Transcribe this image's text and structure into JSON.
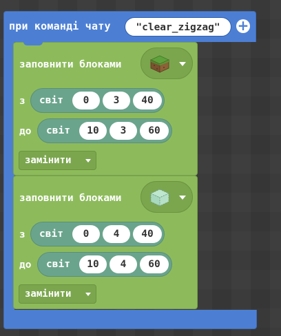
{
  "event": {
    "title": "при команді чату",
    "command": "\"clear_zigzag\"",
    "add_icon": "plus-circle-icon",
    "color": "#4c7fd4"
  },
  "fill_blocks": [
    {
      "label": "заповнити блоками",
      "block_icon": "grass-block-icon",
      "from_label": "з",
      "to_label": "до",
      "from": {
        "name": "світ",
        "x": "0",
        "y": "3",
        "z": "40"
      },
      "to": {
        "name": "світ",
        "x": "10",
        "y": "3",
        "z": "60"
      },
      "mode": "замінити"
    },
    {
      "label": "заповнити блоками",
      "block_icon": "air-block-icon",
      "from_label": "з",
      "to_label": "до",
      "from": {
        "name": "світ",
        "x": "0",
        "y": "4",
        "z": "40"
      },
      "to": {
        "name": "світ",
        "x": "10",
        "y": "4",
        "z": "60"
      },
      "mode": "замінити"
    }
  ],
  "colors": {
    "block_green": "#8dbb5b",
    "position_teal": "#6aa48c"
  }
}
